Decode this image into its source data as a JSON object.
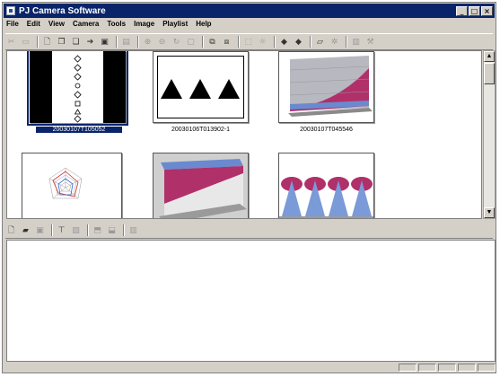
{
  "window": {
    "title": "PJ Camera Software"
  },
  "title_buttons": {
    "minimize": "_",
    "maximize": "□",
    "close": "×"
  },
  "menu": [
    "File",
    "Edit",
    "View",
    "Camera",
    "Tools",
    "Image",
    "Playlist",
    "Help"
  ],
  "thumbnails": [
    {
      "caption": "20030107T105052",
      "selected": true
    },
    {
      "caption": "20030106T013902-1",
      "selected": false
    },
    {
      "caption": "20030107T045546",
      "selected": false
    },
    {
      "caption": "",
      "selected": false
    },
    {
      "caption": "",
      "selected": false
    },
    {
      "caption": "",
      "selected": false
    }
  ],
  "scroll": {
    "up": "▲",
    "down": "▼"
  },
  "colors": {
    "titlebar": "#0a246a",
    "selection": "#0a246a",
    "chart_magenta": "#b0306a",
    "chart_blue": "#6a8ad0"
  }
}
